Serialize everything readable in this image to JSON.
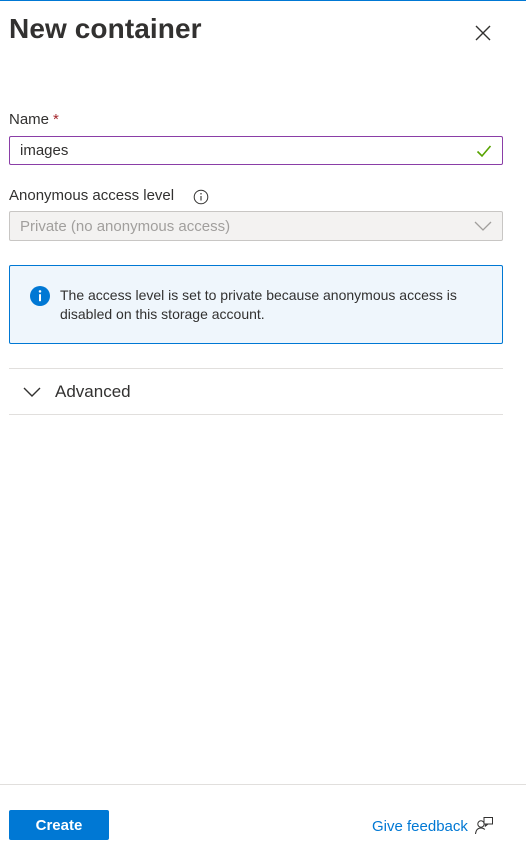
{
  "panel": {
    "title": "New container"
  },
  "name_field": {
    "label": "Name",
    "required_marker": "*",
    "value": "images"
  },
  "access_field": {
    "label": "Anonymous access level",
    "selected": "Private (no anonymous access)"
  },
  "info_message": {
    "text": "The access level is set to private because anonymous access is disabled on this storage account."
  },
  "advanced": {
    "label": "Advanced"
  },
  "footer": {
    "create_label": "Create",
    "feedback_label": "Give feedback"
  },
  "colors": {
    "accent": "#0078d4",
    "input_border_active": "#8a3ea7",
    "valid_check": "#57a300",
    "required": "#a4262c",
    "info_background": "#eff6fc"
  },
  "icons": {
    "close": "close-icon",
    "valid": "checkmark-icon",
    "access_info": "info-circle-icon",
    "dropdown": "chevron-down-icon",
    "message_info": "info-filled-icon",
    "advanced_toggle": "chevron-down-icon",
    "feedback": "feedback-icon"
  }
}
